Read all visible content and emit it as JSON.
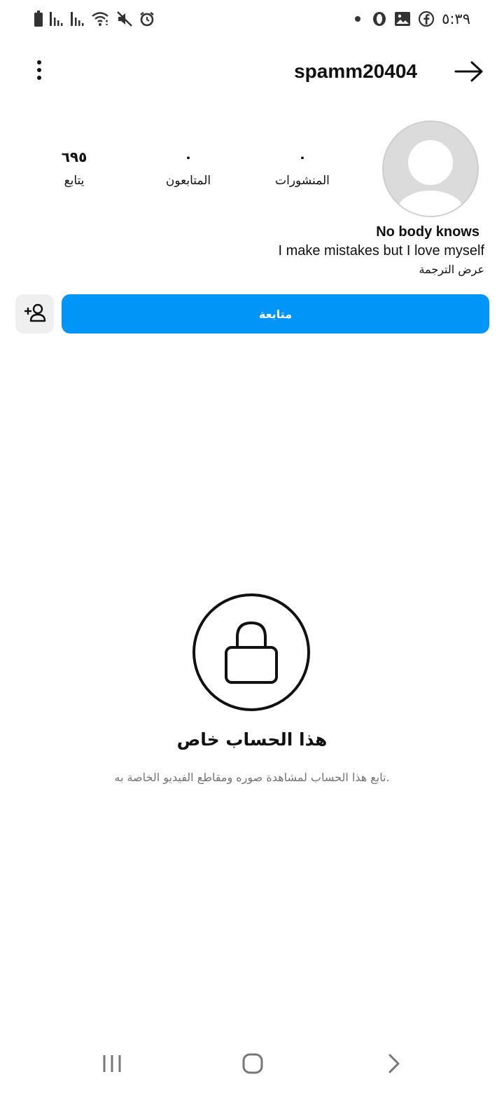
{
  "status_bar": {
    "time": "٥:٣٩",
    "left_icons": [
      "battery-icon",
      "signal-bars-icon",
      "signal-bars-icon",
      "wifi-icon",
      "mute-icon",
      "alarm-icon"
    ],
    "right_icons": [
      "notification-dot-icon",
      "opera-icon",
      "gallery-icon",
      "facebook-icon"
    ]
  },
  "header": {
    "username": "spamm20404",
    "menu_icon": "more-vertical-icon",
    "back_icon": "arrow-right-icon"
  },
  "profile": {
    "stats": [
      {
        "value": "٠",
        "label": "المنشورات"
      },
      {
        "value": "٠",
        "label": "المتابعون"
      },
      {
        "value": "٦٩٥",
        "label": "يتابع"
      }
    ],
    "bio": {
      "name": "No body knows",
      "text": "I make mistakes but I love myself",
      "translate_link": "عرض الترجمة"
    }
  },
  "actions": {
    "follow_label": "متابعة",
    "suggest_icon": "add-person-icon",
    "accent_color": "#0095f6"
  },
  "private_notice": {
    "icon": "lock-icon",
    "title": "هذا الحساب خاص",
    "subtitle": "تابع هذا الحساب لمشاهدة صوره ومقاطع الفيديو الخاصة به."
  },
  "nav_bar": {
    "buttons": [
      "recent-apps-icon",
      "home-icon",
      "back-icon"
    ]
  }
}
